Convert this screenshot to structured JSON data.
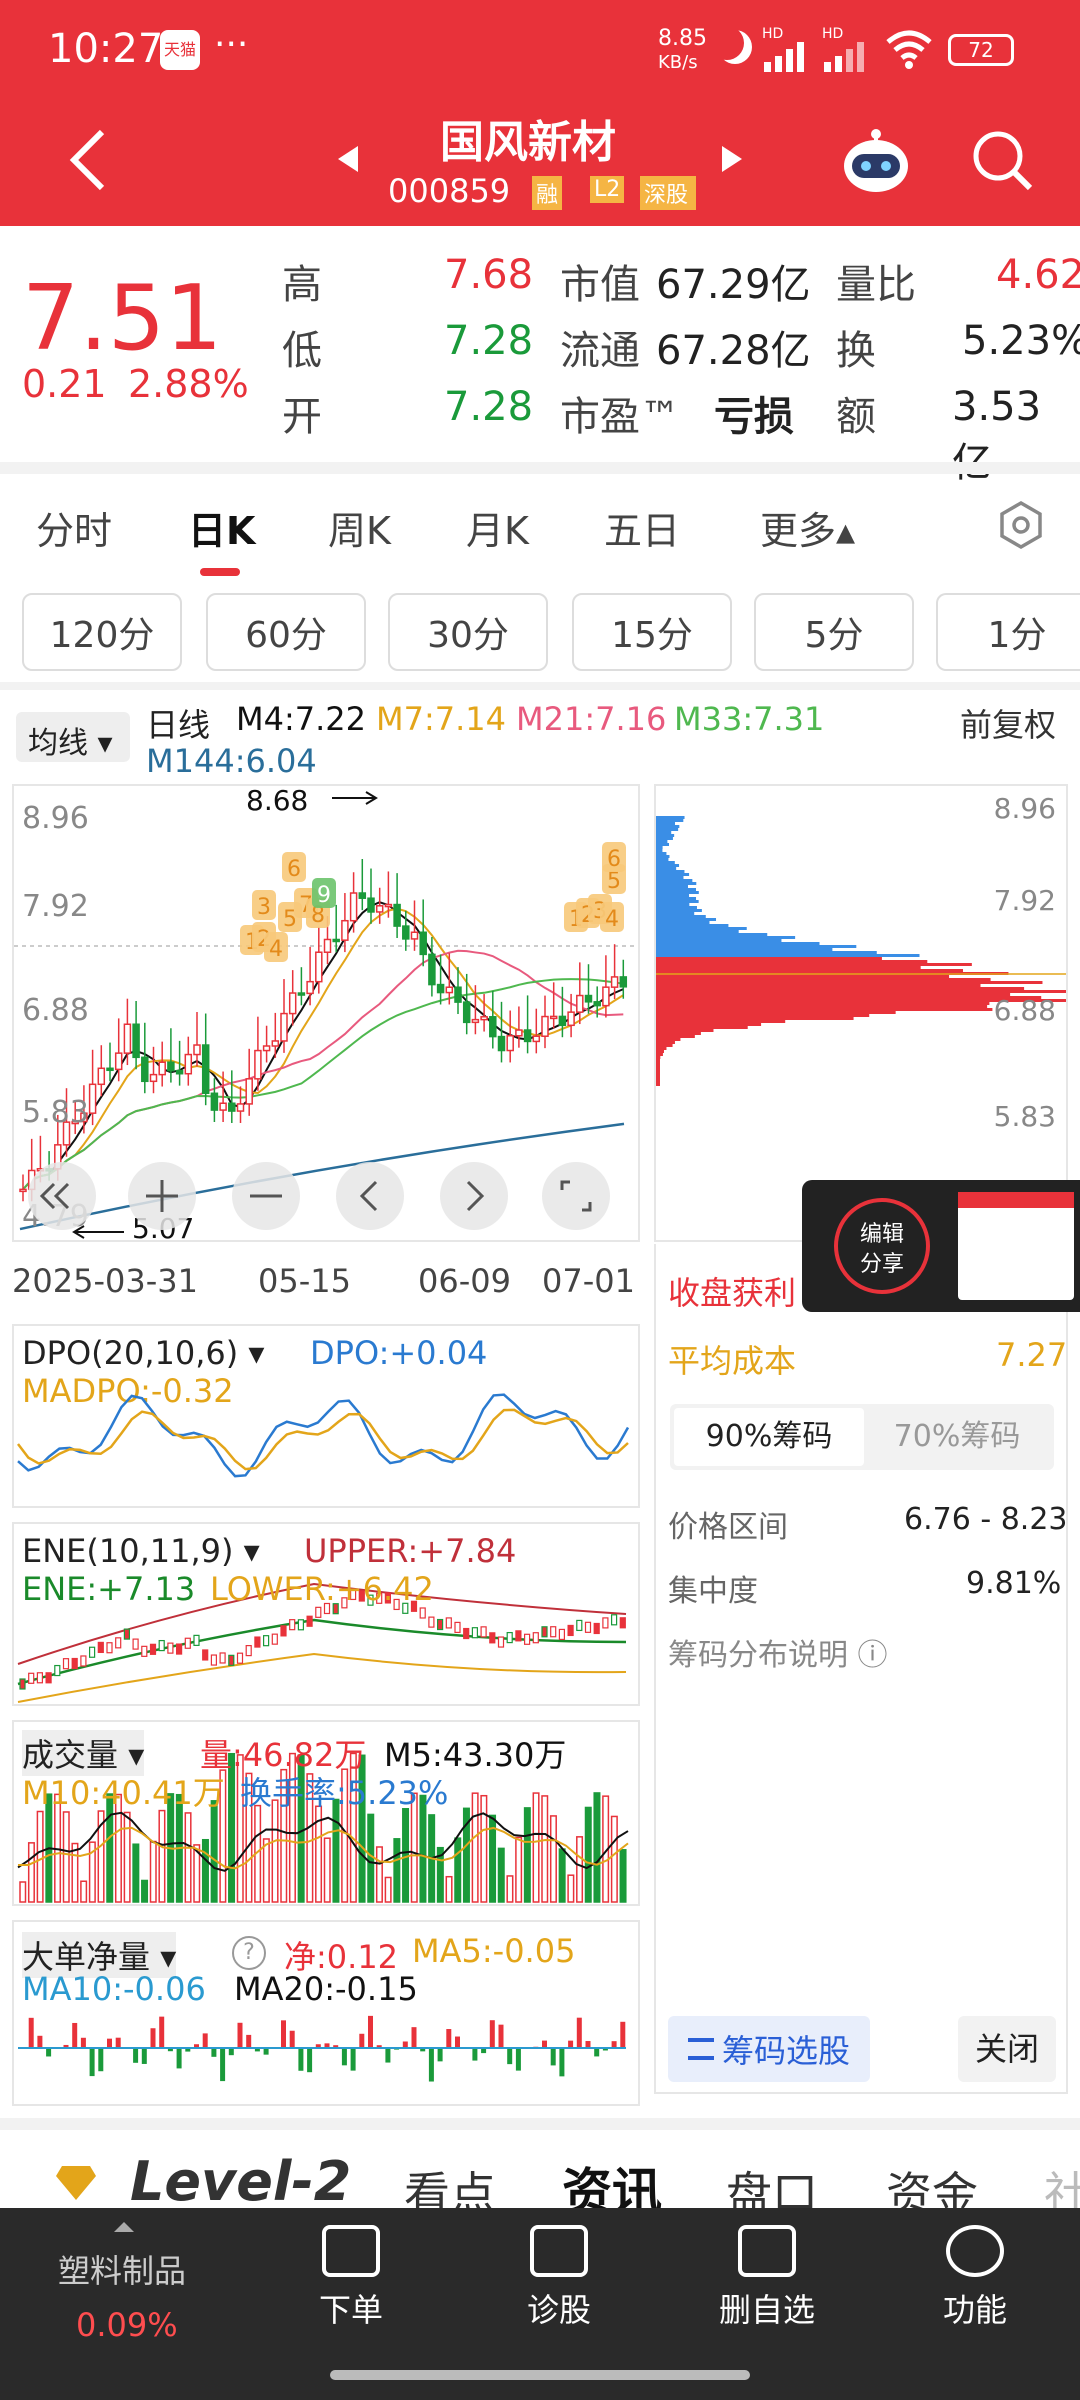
{
  "status": {
    "time": "10:27",
    "badge": "天猫",
    "more": "···",
    "net": "8.85",
    "net_unit": "KB/s",
    "hd1": "HD",
    "hd2": "HD",
    "battery": "72"
  },
  "nav": {
    "title": "国风新材",
    "code": "000859",
    "tag1": "融",
    "tag2": "L2",
    "tag3": "深股"
  },
  "quote": {
    "price": "7.51",
    "change": "0.21",
    "pct": "2.88%",
    "high_lbl": "高",
    "high": "7.68",
    "low_lbl": "低",
    "low": "7.28",
    "open_lbl": "开",
    "open": "7.28",
    "mcap_lbl": "市值",
    "mcap": "67.29亿",
    "float_lbl": "流通",
    "float": "67.28亿",
    "pe_lbl": "市盈™",
    "pe": "亏损",
    "vr_lbl": "量比",
    "vr": "4.62",
    "turn_lbl": "换",
    "turn": "5.23%",
    "amt_lbl": "额",
    "amt": "3.53亿"
  },
  "tabs": [
    "分时",
    "日K",
    "周K",
    "月K",
    "五日",
    "更多▴"
  ],
  "intervals": [
    "120分",
    "60分",
    "30分",
    "15分",
    "5分",
    "1分"
  ],
  "kline": {
    "selector": "均线",
    "type": "日线",
    "m4": "M4:7.22",
    "m7": "M7:7.14",
    "m21": "M21:7.16",
    "m33": "M33:7.31",
    "m144": "M144:6.04",
    "adj": "前复权",
    "y_labels": [
      "8.96",
      "7.92",
      "6.88",
      "5.83",
      "4.79"
    ],
    "max_label": "8.68",
    "min_label": "5.07",
    "dates": [
      "2025-03-31",
      "05-15",
      "06-09",
      "07-01"
    ]
  },
  "chips": {
    "y_labels": [
      "8.96",
      "7.92",
      "6.88",
      "5.83"
    ],
    "profit_lbl": "收盘获利",
    "avg_lbl": "平均成本",
    "avg": "7.27",
    "tab90": "90%筹码",
    "tab70": "70%筹码",
    "range_lbl": "价格区间",
    "range": "6.76 - 8.23",
    "conc_lbl": "集中度",
    "conc": "9.81%",
    "explain": "筹码分布说明 ⓘ",
    "select_btn": "筹码选股",
    "close_btn": "关闭"
  },
  "share": {
    "line1": "编辑",
    "line2": "分享"
  },
  "dpo": {
    "name": "DPO(20,10,6)",
    "dpo": "DPO:+0.04",
    "madpo": "MADPO:-0.32"
  },
  "ene": {
    "name": "ENE(10,11,9)",
    "upper": "UPPER:+7.84",
    "ene": "ENE:+7.13",
    "lower": "LOWER:+6.42"
  },
  "vol": {
    "name": "成交量",
    "vol": "量:46.82万",
    "m5": "M5:43.30万",
    "m10": "M10:40.41万",
    "turn": "换手率:5.23%"
  },
  "big": {
    "name": "大单净量",
    "net": "净:0.12",
    "ma5": "MA5:-0.05",
    "ma10": "MA10:-0.06",
    "ma20": "MA20:-0.15"
  },
  "subtabs": [
    "Level-2",
    "看点",
    "资讯",
    "盘口",
    "资金",
    "社"
  ],
  "bottom": {
    "sector": "塑料制品",
    "sector_pct": "0.09%",
    "b1": "下单",
    "b2": "诊股",
    "b3": "删自选",
    "b4": "功能"
  },
  "colors": {
    "up": "#e8323a",
    "down": "#1a9a3a",
    "accent": "#e8323a"
  }
}
